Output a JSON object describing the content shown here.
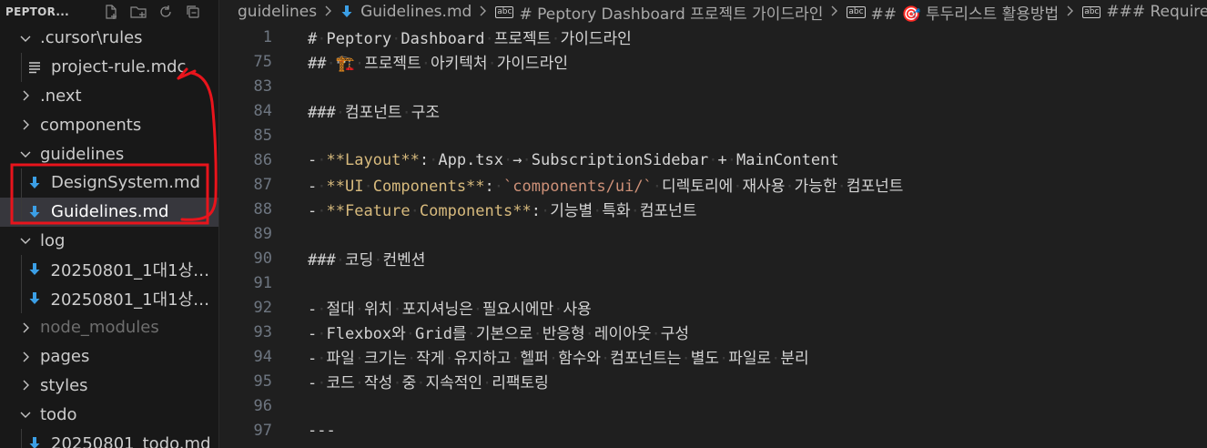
{
  "explorer": {
    "title": "PEPTOR...",
    "actions": [
      {
        "icon": "new-file-icon"
      },
      {
        "icon": "new-folder-icon"
      },
      {
        "icon": "refresh-icon"
      },
      {
        "icon": "collapse-all-icon"
      }
    ],
    "items": [
      {
        "label": ".cursor\\rules",
        "type": "folder",
        "expanded": true,
        "depth": 0
      },
      {
        "label": "project-rule.mdc",
        "type": "file",
        "icon": "lines-file-icon",
        "depth": 1
      },
      {
        "label": ".next",
        "type": "folder",
        "expanded": false,
        "depth": 0
      },
      {
        "label": "components",
        "type": "folder",
        "expanded": false,
        "depth": 0
      },
      {
        "label": "guidelines",
        "type": "folder",
        "expanded": true,
        "depth": 0
      },
      {
        "label": "DesignSystem.md",
        "type": "file",
        "icon": "markdown-download-icon",
        "depth": 1
      },
      {
        "label": "Guidelines.md",
        "type": "file",
        "icon": "markdown-download-icon",
        "depth": 1,
        "selected": true
      },
      {
        "label": "log",
        "type": "folder",
        "expanded": true,
        "depth": 0
      },
      {
        "label": "20250801_1대1상담...",
        "type": "file",
        "icon": "markdown-download-icon",
        "depth": 1
      },
      {
        "label": "20250801_1대1상담...",
        "type": "file",
        "icon": "markdown-download-icon",
        "depth": 1
      },
      {
        "label": "node_modules",
        "type": "folder",
        "expanded": false,
        "depth": 0,
        "dim": true
      },
      {
        "label": "pages",
        "type": "folder",
        "expanded": false,
        "depth": 0
      },
      {
        "label": "styles",
        "type": "folder",
        "expanded": false,
        "depth": 0
      },
      {
        "label": "todo",
        "type": "folder",
        "expanded": true,
        "depth": 0
      },
      {
        "label": "20250801_todo.md",
        "type": "file",
        "icon": "markdown-download-icon",
        "depth": 1
      }
    ]
  },
  "breadcrumb": [
    {
      "text": "guidelines"
    },
    {
      "text": "Guidelines.md",
      "icon": "markdown-download-icon"
    },
    {
      "text": "# Peptory Dashboard 프로젝트 가이드라인",
      "icon": "abc-symbol-icon"
    },
    {
      "text": "## 🎯 투두리스트 활용방법",
      "icon": "abc-symbol-icon"
    },
    {
      "text": "### Require",
      "icon": "abc-symbol-icon"
    }
  ],
  "code_lines": [
    {
      "num": "1",
      "parts": [
        {
          "t": "# Peptory Dashboard 프로젝트 가이드라인",
          "c": "txt"
        }
      ]
    },
    {
      "num": "75",
      "parts": [
        {
          "t": "## 🏗️ 프로젝트 아키텍처 가이드라인",
          "c": "txt"
        }
      ]
    },
    {
      "num": "83",
      "parts": []
    },
    {
      "num": "84",
      "parts": [
        {
          "t": "### 컴포넌트 구조",
          "c": "txt"
        }
      ]
    },
    {
      "num": "85",
      "parts": []
    },
    {
      "num": "86",
      "parts": [
        {
          "t": "- ",
          "c": "txt"
        },
        {
          "t": "**Layout**",
          "c": "bold"
        },
        {
          "t": ": App.tsx → SubscriptionSidebar + MainContent",
          "c": "txt"
        }
      ]
    },
    {
      "num": "87",
      "parts": [
        {
          "t": "- ",
          "c": "txt"
        },
        {
          "t": "**UI Components**",
          "c": "bold"
        },
        {
          "t": ": ",
          "c": "txt"
        },
        {
          "t": "`components/ui/`",
          "c": "inline"
        },
        {
          "t": " 디렉토리에 재사용 가능한 컴포넌트",
          "c": "txt"
        }
      ]
    },
    {
      "num": "88",
      "parts": [
        {
          "t": "- ",
          "c": "txt"
        },
        {
          "t": "**Feature Components**",
          "c": "bold"
        },
        {
          "t": ": 기능별 특화 컴포넌트",
          "c": "txt"
        }
      ]
    },
    {
      "num": "89",
      "parts": []
    },
    {
      "num": "90",
      "parts": [
        {
          "t": "### 코딩 컨벤션",
          "c": "txt"
        }
      ]
    },
    {
      "num": "91",
      "parts": []
    },
    {
      "num": "92",
      "parts": [
        {
          "t": "- 절대 위치 포지셔닝은 필요시에만 사용",
          "c": "txt"
        }
      ]
    },
    {
      "num": "93",
      "parts": [
        {
          "t": "- Flexbox와 Grid를 기본으로 반응형 레이아웃 구성",
          "c": "txt"
        }
      ]
    },
    {
      "num": "94",
      "parts": [
        {
          "t": "- 파일 크기는 작게 유지하고 헬퍼 함수와 컴포넌트는 별도 파일로 분리",
          "c": "txt"
        }
      ]
    },
    {
      "num": "95",
      "parts": [
        {
          "t": "- 코드 작성 중 지속적인 리팩토링",
          "c": "txt"
        }
      ]
    },
    {
      "num": "96",
      "parts": []
    },
    {
      "num": "97",
      "parts": [
        {
          "t": "---",
          "c": "txt"
        }
      ]
    }
  ],
  "colors": {
    "annotation": "#e8141c",
    "markdown_icon": "#3b9fe6",
    "bold_text": "#d7ba7d",
    "inline_code": "#ce9178"
  }
}
